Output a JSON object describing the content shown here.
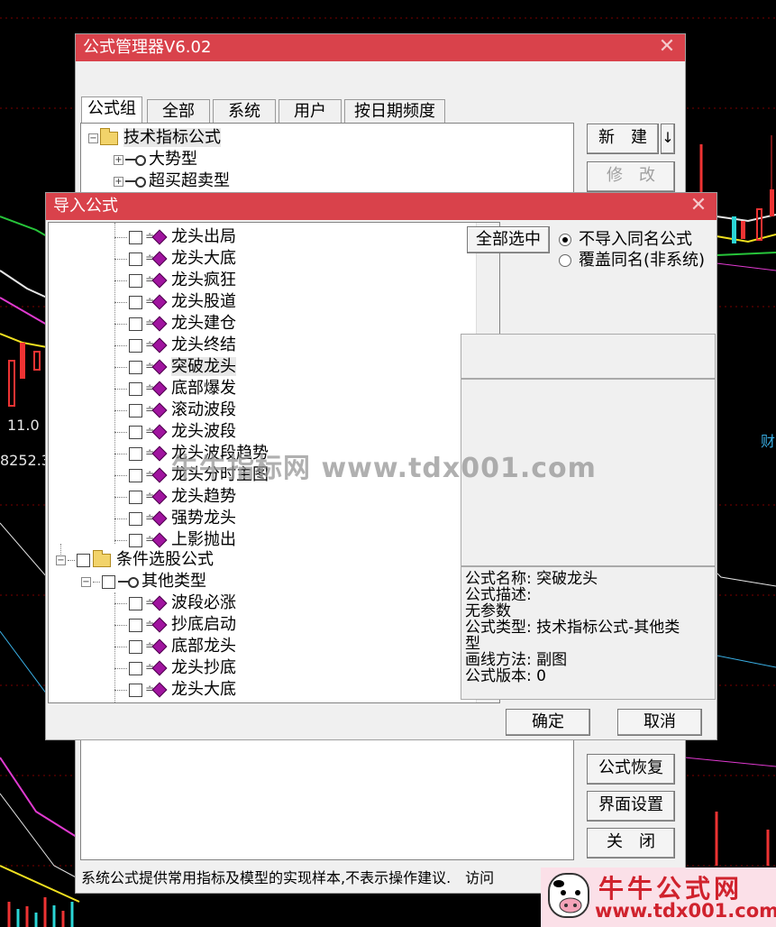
{
  "background": {
    "price_label": "11.0",
    "value_label": "8252.3",
    "right_label": "财"
  },
  "manager": {
    "title": "公式管理器V6.02",
    "close_glyph": "✕",
    "tabs": [
      "公式组",
      "全部",
      "系统",
      "用户",
      "按日期频度"
    ],
    "tree": {
      "root_label": "技术指标公式",
      "children": [
        "大势型",
        "超买超卖型"
      ]
    },
    "buttons": {
      "new": "新　建",
      "new_dropdown": "↓",
      "modify": "修　改",
      "restore": "公式恢复",
      "ui_settings": "界面设置",
      "close": "关　闭"
    },
    "status_text": "系统公式提供常用指标及模型的实现样本,不表示操作建议.　访问"
  },
  "import_dialog": {
    "title": "导入公式",
    "close_glyph": "✕",
    "select_all_label": "全部选中",
    "options": [
      {
        "label": "不导入同名公式",
        "selected": true
      },
      {
        "label": "覆盖同名(非系统)",
        "selected": false
      }
    ],
    "tree_items_top": [
      "龙头出局",
      "龙头大底",
      "龙头疯狂",
      "龙头股道",
      "龙头建仓",
      "龙头终结",
      "突破龙头",
      "底部爆发",
      "滚动波段",
      "龙头波段",
      "龙头波段趋势",
      "龙头分时主图",
      "龙头趋势",
      "强势龙头",
      "上影抛出"
    ],
    "highlighted_item": "突破龙头",
    "group_label": "条件选股公式",
    "subgroup_label": "其他类型",
    "tree_items_bottom": [
      "波段必涨",
      "抄底启动",
      "底部龙头",
      "龙头抄底",
      "龙头大底"
    ],
    "info": {
      "name_line": "公式名称: 突破龙头",
      "desc_line": "公式描述:",
      "params_line": "无参数",
      "type_line": "公式类型: 技术指标公式-其他类",
      "type_line_2": "型",
      "draw_line": "画线方法: 副图",
      "version_line": "公式版本: 0"
    },
    "ok_label": "确定",
    "cancel_label": "取消"
  },
  "watermark": "牛牛指标网 www.tdx001.com",
  "logo": {
    "title": "牛牛公式网",
    "url": "www.tdx001.com"
  },
  "colors": {
    "titlebar": "#d9424b",
    "item_icon": "#a0149f"
  }
}
